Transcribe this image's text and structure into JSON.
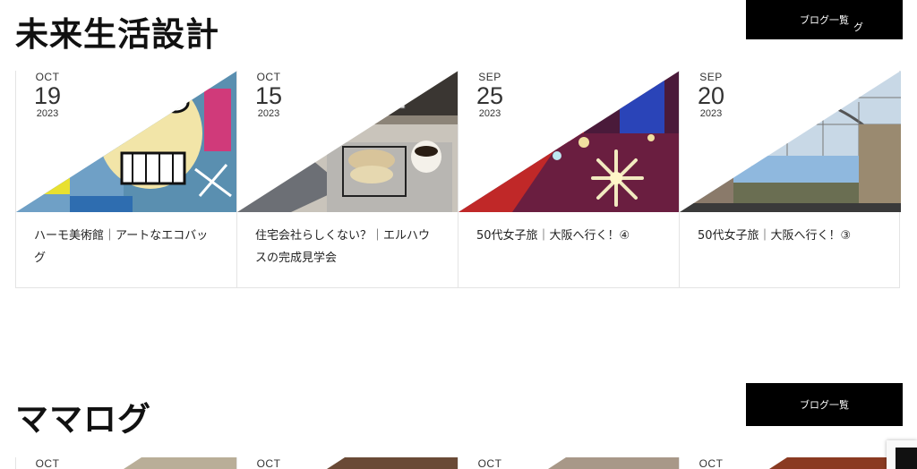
{
  "sections": [
    {
      "title": "未来生活設計",
      "button_label": "ブログ一覧",
      "button_extra": "グ",
      "cards": [
        {
          "month": "OCT",
          "day": "19",
          "year": "2023",
          "title": "ハーモ美術館｜アートなエコバッグ"
        },
        {
          "month": "OCT",
          "day": "15",
          "year": "2023",
          "title": "住宅会社らしくない？｜エルハウスの完成見学会"
        },
        {
          "month": "SEP",
          "day": "25",
          "year": "2023",
          "title": "50代女子旅｜大阪へ行く！④"
        },
        {
          "month": "SEP",
          "day": "20",
          "year": "2023",
          "title": "50代女子旅｜大阪へ行く！③"
        }
      ]
    },
    {
      "title": "ママログ",
      "button_label": "ブログ一覧",
      "cards": [
        {
          "month": "OCT"
        },
        {
          "month": "OCT"
        },
        {
          "month": "OCT"
        },
        {
          "month": "OCT"
        }
      ]
    }
  ],
  "colors": {
    "button_bg": "#000000",
    "border": "#e4e4e4",
    "text": "#222222"
  }
}
